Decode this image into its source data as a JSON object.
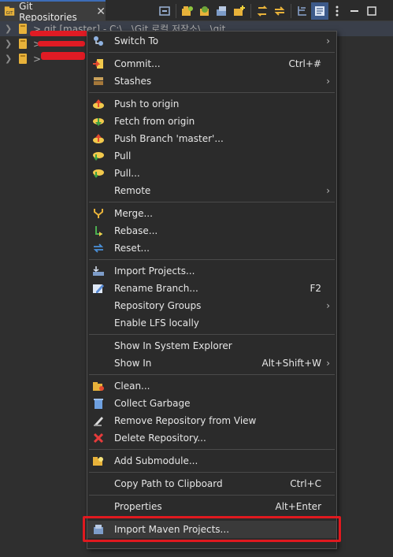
{
  "tab": {
    "title": "Git Repositories",
    "close": "✕"
  },
  "toolbar": {
    "icons": [
      "collapse-all-icon",
      "clone-repo-icon",
      "add-repo-icon",
      "create-repo-icon",
      "new-folder-icon",
      "refresh-icon",
      "link-with-editor-icon",
      "tree-layout-icon",
      "show-view-icon",
      "view-menu-icon"
    ]
  },
  "tree": {
    "rows": [
      {
        "label": "> git [master] - C:\\...\\Git 로컬 저장소\\...\\git",
        "selected": true
      },
      {
        "label": "> ",
        "selected": false
      },
      {
        "label": "> ",
        "selected": false
      }
    ]
  },
  "menu": {
    "items": [
      {
        "type": "item",
        "icon": "switch-icon",
        "label": "Switch To",
        "accel": "",
        "submenu": true
      },
      {
        "type": "sep"
      },
      {
        "type": "item",
        "icon": "commit-icon",
        "label": "Commit...",
        "accel": "Ctrl+#",
        "submenu": false
      },
      {
        "type": "item",
        "icon": "stashes-icon",
        "label": "Stashes",
        "accel": "",
        "submenu": true
      },
      {
        "type": "sep"
      },
      {
        "type": "item",
        "icon": "push-icon",
        "label": "Push to origin",
        "accel": "",
        "submenu": false
      },
      {
        "type": "item",
        "icon": "fetch-icon",
        "label": "Fetch from origin",
        "accel": "",
        "submenu": false
      },
      {
        "type": "item",
        "icon": "push-branch-icon",
        "label": "Push Branch 'master'...",
        "accel": "",
        "submenu": false
      },
      {
        "type": "item",
        "icon": "pull-icon",
        "label": "Pull",
        "accel": "",
        "submenu": false
      },
      {
        "type": "item",
        "icon": "pull-dialog-icon",
        "label": "Pull...",
        "accel": "",
        "submenu": false
      },
      {
        "type": "item",
        "icon": "",
        "label": "Remote",
        "accel": "",
        "submenu": true
      },
      {
        "type": "sep"
      },
      {
        "type": "item",
        "icon": "merge-icon",
        "label": "Merge...",
        "accel": "",
        "submenu": false
      },
      {
        "type": "item",
        "icon": "rebase-icon",
        "label": "Rebase...",
        "accel": "",
        "submenu": false
      },
      {
        "type": "item",
        "icon": "reset-icon",
        "label": "Reset...",
        "accel": "",
        "submenu": false
      },
      {
        "type": "sep"
      },
      {
        "type": "item",
        "icon": "import-projects-icon",
        "label": "Import Projects...",
        "accel": "",
        "submenu": false
      },
      {
        "type": "item",
        "icon": "rename-icon",
        "label": "Rename Branch...",
        "accel": "F2",
        "submenu": false
      },
      {
        "type": "item",
        "icon": "",
        "label": "Repository Groups",
        "accel": "",
        "submenu": true
      },
      {
        "type": "item",
        "icon": "",
        "label": "Enable LFS locally",
        "accel": "",
        "submenu": false
      },
      {
        "type": "sep"
      },
      {
        "type": "item",
        "icon": "",
        "label": "Show In System Explorer",
        "accel": "",
        "submenu": false
      },
      {
        "type": "item",
        "icon": "",
        "label": "Show In",
        "accel": "Alt+Shift+W",
        "submenu": true
      },
      {
        "type": "sep"
      },
      {
        "type": "item",
        "icon": "clean-icon",
        "label": "Clean...",
        "accel": "",
        "submenu": false
      },
      {
        "type": "item",
        "icon": "garbage-icon",
        "label": "Collect Garbage",
        "accel": "",
        "submenu": false
      },
      {
        "type": "item",
        "icon": "remove-repo-icon",
        "label": "Remove Repository from View",
        "accel": "",
        "submenu": false
      },
      {
        "type": "item",
        "icon": "delete-icon",
        "label": "Delete Repository...",
        "accel": "",
        "submenu": false
      },
      {
        "type": "sep"
      },
      {
        "type": "item",
        "icon": "submodule-icon",
        "label": "Add Submodule...",
        "accel": "",
        "submenu": false
      },
      {
        "type": "sep"
      },
      {
        "type": "item",
        "icon": "",
        "label": "Copy Path to Clipboard",
        "accel": "Ctrl+C",
        "submenu": false
      },
      {
        "type": "sep"
      },
      {
        "type": "item",
        "icon": "",
        "label": "Properties",
        "accel": "Alt+Enter",
        "submenu": false
      },
      {
        "type": "sep"
      },
      {
        "type": "item",
        "icon": "maven-import-icon",
        "label": "Import Maven Projects...",
        "accel": "",
        "submenu": false,
        "highlight": true
      }
    ]
  },
  "colors": {
    "annotation_red": "#e0191f",
    "accent_blue": "#3d6cb7"
  }
}
